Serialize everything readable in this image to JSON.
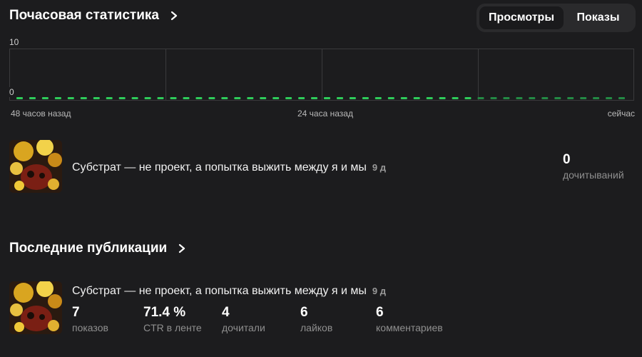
{
  "hourly": {
    "title": "Почасовая статистика",
    "tabs": [
      {
        "label": "Просмотры",
        "active": true
      },
      {
        "label": "Показы",
        "active": false
      }
    ],
    "y_ticks": [
      "10",
      "0"
    ],
    "x_labels": [
      "48 часов назад",
      "24 часа назад",
      "сейчас"
    ]
  },
  "chart_data": {
    "type": "bar",
    "categories_count": 48,
    "values": [
      0,
      0,
      0,
      0,
      0,
      0,
      0,
      0,
      0,
      0,
      0,
      0,
      0,
      0,
      0,
      0,
      0,
      0,
      0,
      0,
      0,
      0,
      0,
      0,
      0,
      0,
      0,
      0,
      0,
      0,
      0,
      0,
      0,
      0,
      0,
      0,
      0,
      0,
      0,
      0,
      0,
      0,
      0,
      0,
      0,
      0,
      0,
      0
    ],
    "ylim": [
      0,
      10
    ],
    "y_ticks": [
      0,
      10
    ],
    "x_tick_labels": [
      "48 часов назад",
      "24 часа назад",
      "сейчас"
    ],
    "grid": true,
    "colors": {
      "bar": "#2ecc5a",
      "bar_faded": "#238a44",
      "grid": "#3a3a3c"
    }
  },
  "top_item": {
    "title": "Субстрат — не проект, а попытка выжить между я и мы",
    "age": "9 д",
    "metric_value": "0",
    "metric_label": "дочитываний"
  },
  "recent": {
    "title": "Последние публикации",
    "item": {
      "title": "Субстрат — не проект, а попытка выжить между я и мы",
      "age": "9 д",
      "stats": [
        {
          "value": "7",
          "label": "показов"
        },
        {
          "value": "71.4 %",
          "label": "CTR в ленте"
        },
        {
          "value": "4",
          "label": "дочитали"
        },
        {
          "value": "6",
          "label": "лайков"
        },
        {
          "value": "6",
          "label": "комментариев"
        }
      ]
    }
  },
  "icons": {
    "section_link": "chevron-right-icon"
  },
  "colors": {
    "background": "#1c1c1e",
    "accent_green": "#2ecc5a",
    "muted_text": "#8f8f8f"
  }
}
